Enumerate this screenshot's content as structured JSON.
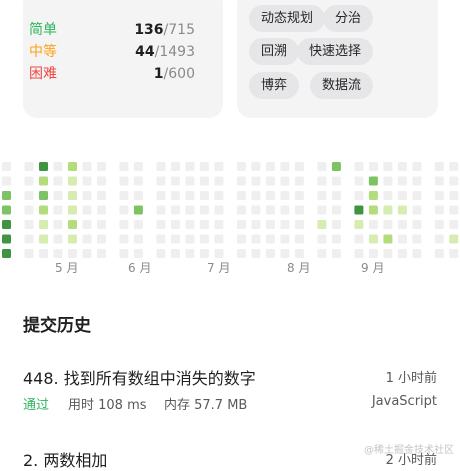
{
  "difficulty": {
    "easy": {
      "label": "简单",
      "solved": "136",
      "total": "/715",
      "color": "#2db55d"
    },
    "medium": {
      "label": "中等",
      "solved": "44",
      "total": "/1493",
      "color": "#ffa116"
    },
    "hard": {
      "label": "困难",
      "solved": "1",
      "total": "/600",
      "color": "#ef4743"
    }
  },
  "tags": [
    "动态规划",
    "分治",
    "回溯",
    "快速选择",
    "博弈",
    "数据流"
  ],
  "calendar": {
    "months": [
      "5 月",
      "6 月",
      "7 月",
      "8 月",
      "9 月"
    ],
    "colors": {
      "0": "#efefef",
      "1": "#d6ecb0",
      "2": "#b3dc7d",
      "3": "#7dc363",
      "4": "#3e9440"
    },
    "weeks": [
      [
        0,
        0,
        3,
        3,
        4,
        4,
        4
      ],
      [],
      [
        0,
        0,
        0,
        0,
        0,
        0,
        0
      ],
      [
        4,
        2,
        3,
        2,
        1,
        1,
        0
      ],
      [
        0,
        0,
        0,
        0,
        0,
        0,
        0
      ],
      [
        2,
        1,
        1,
        1,
        2,
        1,
        0
      ],
      [
        0,
        0,
        0,
        0,
        0,
        0,
        0
      ],
      [
        0,
        0,
        0,
        0,
        0,
        0,
        0
      ],
      [],
      [
        0,
        0,
        0,
        0,
        0,
        0,
        0
      ],
      [
        0,
        0,
        0,
        3,
        0,
        0,
        0
      ],
      [],
      [
        0,
        0,
        0,
        0,
        0,
        0,
        0
      ],
      [
        0,
        0,
        0,
        0,
        0,
        0,
        0
      ],
      [
        0,
        0,
        0,
        0,
        0,
        0,
        0
      ],
      [
        0,
        0,
        0,
        0,
        0,
        0,
        0
      ],
      [
        0,
        0,
        0,
        0,
        0,
        0,
        0
      ],
      [],
      [
        0,
        0,
        0,
        0,
        0,
        0,
        0
      ],
      [
        0,
        0,
        0,
        0,
        0,
        0,
        0
      ],
      [
        0,
        0,
        0,
        0,
        0,
        0,
        0
      ],
      [
        0,
        0,
        0,
        0,
        0,
        0,
        0
      ],
      [
        0,
        0,
        0,
        0,
        0,
        0,
        0
      ],
      [],
      [
        0,
        0,
        0,
        0,
        1,
        0,
        0
      ],
      [
        3,
        0,
        0,
        0,
        0,
        0,
        0
      ],
      [],
      [
        0,
        0,
        0,
        4,
        1,
        0,
        0
      ],
      [
        0,
        3,
        2,
        2,
        0,
        1,
        0
      ],
      [
        0,
        0,
        0,
        1,
        0,
        2,
        0
      ],
      [
        0,
        0,
        0,
        1,
        0,
        0,
        0
      ],
      [
        0,
        0,
        0,
        0,
        0,
        0,
        0
      ],
      [],
      [
        0,
        0,
        0,
        0,
        0,
        0,
        0
      ],
      [
        0,
        0,
        0,
        0,
        0,
        1,
        0
      ],
      [],
      [
        3,
        0,
        0,
        0,
        0,
        0,
        0
      ],
      [
        2,
        3,
        1,
        0,
        1,
        2,
        2
      ],
      [
        2,
        3,
        2,
        3,
        2,
        1,
        0
      ],
      [
        2,
        1,
        0,
        4,
        1,
        0,
        0
      ],
      [
        1,
        0,
        0,
        0,
        0,
        0,
        0
      ],
      [],
      [
        0,
        0,
        0,
        0,
        0,
        0,
        2
      ]
    ]
  },
  "history": {
    "title": "提交历史",
    "items": [
      {
        "title": "448. 找到所有数组中消失的数字",
        "time": "1 小时前",
        "status": "通过",
        "runtime": "用时 108 ms",
        "memory": "内存 57.7 MB",
        "language": "JavaScript"
      },
      {
        "title": "2. 两数相加",
        "time": "2 小时前"
      }
    ]
  },
  "watermark": "@稀土掘金技术社区"
}
